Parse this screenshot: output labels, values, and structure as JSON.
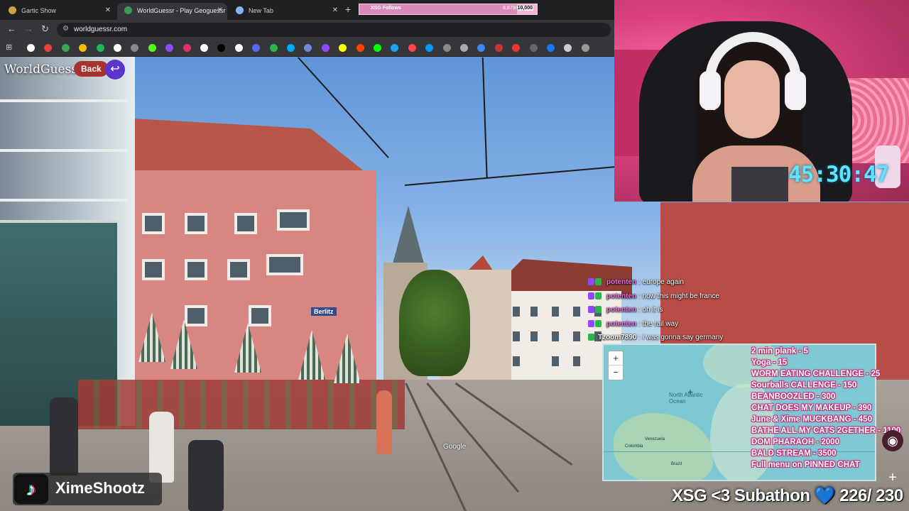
{
  "browser": {
    "tabs": [
      {
        "label": "Gartic Show",
        "active": false
      },
      {
        "label": "WorldGuessr - Play Geoguessr Free",
        "active": true
      },
      {
        "label": "New Tab",
        "active": false
      }
    ],
    "address": "worldguessr.com"
  },
  "goal_bar": {
    "label": "XSG Follows",
    "current": "8,879",
    "target": "10,000",
    "progress": 0.8879,
    "color": "#f3b5d6"
  },
  "game": {
    "brand": "WorldGuessr",
    "back_label": "Back",
    "undo_icon": "undo-arrow-icon",
    "sign_text": "Berlitz",
    "imagery_credit": "Google"
  },
  "webcam": {
    "timer": "45:30:47",
    "timer_color": "#5fe3ff"
  },
  "chat": [
    {
      "user": "potenten",
      "message": "europe again",
      "user_color": "#e86fe0"
    },
    {
      "user": "potenten",
      "message": "now this might be france",
      "user_color": "#e86fe0"
    },
    {
      "user": "potenten",
      "message": "oh it is",
      "user_color": "#e86fe0"
    },
    {
      "user": "potenten",
      "message": "the rail way",
      "user_color": "#e86fe0"
    },
    {
      "user": "Tzoom7890",
      "message": "i was gonna say germany",
      "user_color": "#ffffff"
    }
  ],
  "map": {
    "zoom_in": "+",
    "zoom_out": "−",
    "ocean_label": "North Atlantic Ocean",
    "places": [
      "Venezuela",
      "Colombia",
      "Brazil"
    ]
  },
  "menu": [
    "2 min plank  -  5",
    "Yoga  -  15",
    "WORM EATING CHALLENGE  -  25",
    "Sourballs CALLENGE  - 150",
    "BEANBOOZLED - 300",
    "CHAT DOES MY MAKEUP - 390",
    "June & Xime MUCKBANG - 450",
    "BATHE ALL MY CATS 2GETHER - 1100",
    "DOM PHARAOH - 2000",
    "BALD STREAM - 3500",
    "Full menu on PINNED CHAT"
  ],
  "overlay": {
    "tiktok_handle": "XimeShootz",
    "subathon_text": "XSG <3 Subathon",
    "subathon_heart": "💙",
    "subathon_count": "226",
    "subathon_sep": "/",
    "subathon_total": "230"
  }
}
